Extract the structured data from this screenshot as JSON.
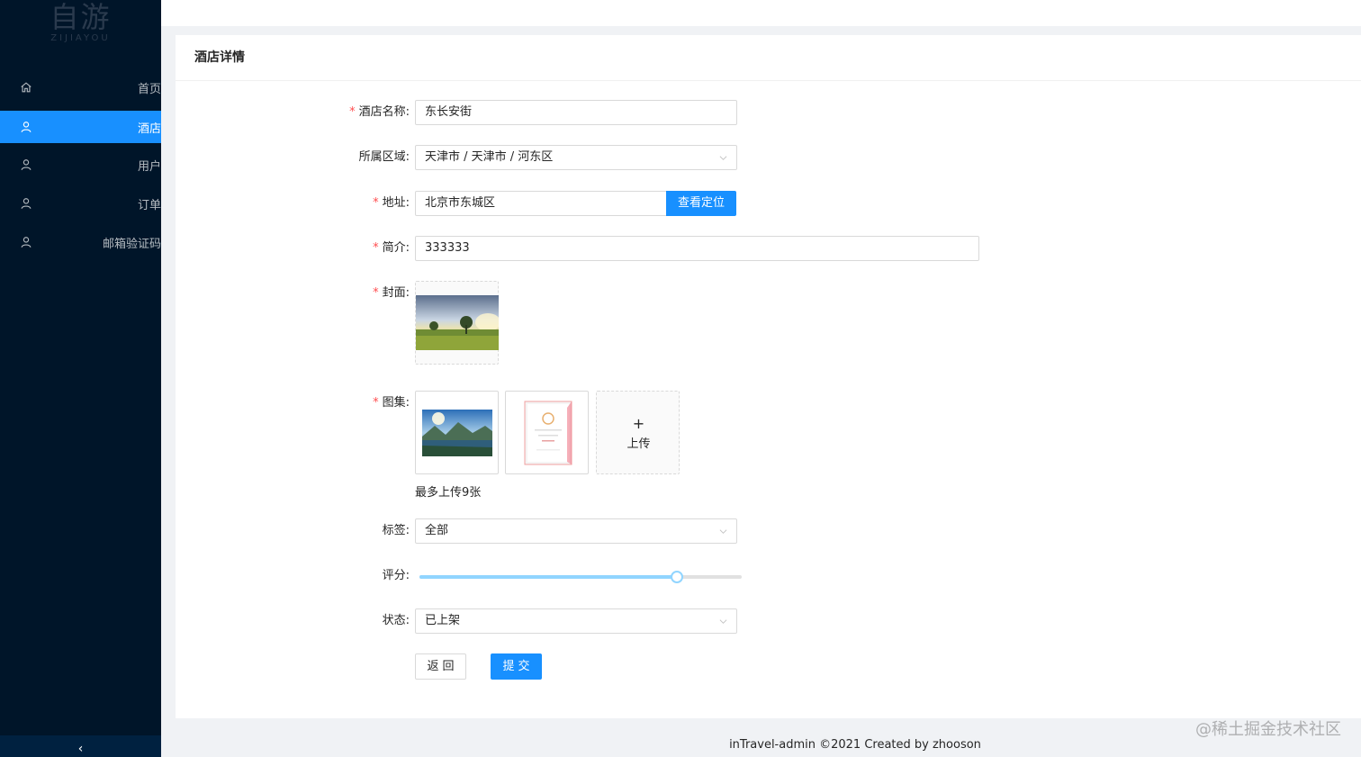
{
  "app": {
    "logo_main": "自游",
    "logo_sub": "ZIJIAYOU"
  },
  "sidebar": {
    "items": [
      {
        "label": "首页",
        "icon": "home-icon",
        "active": false
      },
      {
        "label": "酒店",
        "icon": "user-icon",
        "active": true
      },
      {
        "label": "用户",
        "icon": "user-icon",
        "active": false
      },
      {
        "label": "订单",
        "icon": "user-icon",
        "active": false
      },
      {
        "label": "邮箱验证码",
        "icon": "user-icon",
        "active": false
      }
    ],
    "collapse_icon": "‹"
  },
  "card": {
    "title": "酒店详情"
  },
  "form": {
    "name": {
      "label": "酒店名称:",
      "value": "东长安街",
      "required": true
    },
    "region": {
      "label": "所属区域:",
      "value": "天津市 / 天津市 / 河东区",
      "required": false
    },
    "address": {
      "label": "地址:",
      "value": "北京市东城区",
      "button": "查看定位",
      "required": true
    },
    "intro": {
      "label": "简介:",
      "value": "333333",
      "required": true
    },
    "cover": {
      "label": "封面:",
      "required": true
    },
    "gallery": {
      "label": "图集:",
      "upload_plus": "+",
      "upload_text": "上传",
      "hint": "最多上传9张",
      "required": true
    },
    "tags": {
      "label": "标签:",
      "value": "全部"
    },
    "rating": {
      "label": "评分:",
      "value_fraction": 0.8
    },
    "status": {
      "label": "状态:",
      "value": "已上架"
    },
    "back_button": "返回",
    "submit_button": "提交"
  },
  "footer": {
    "text": "inTravel-admin ©2021 Created by zhooson"
  },
  "watermark": "@稀土掘金技术社区",
  "colors": {
    "sidebar_bg": "#001529",
    "primary": "#1890ff",
    "required": "#ff4d4f"
  }
}
